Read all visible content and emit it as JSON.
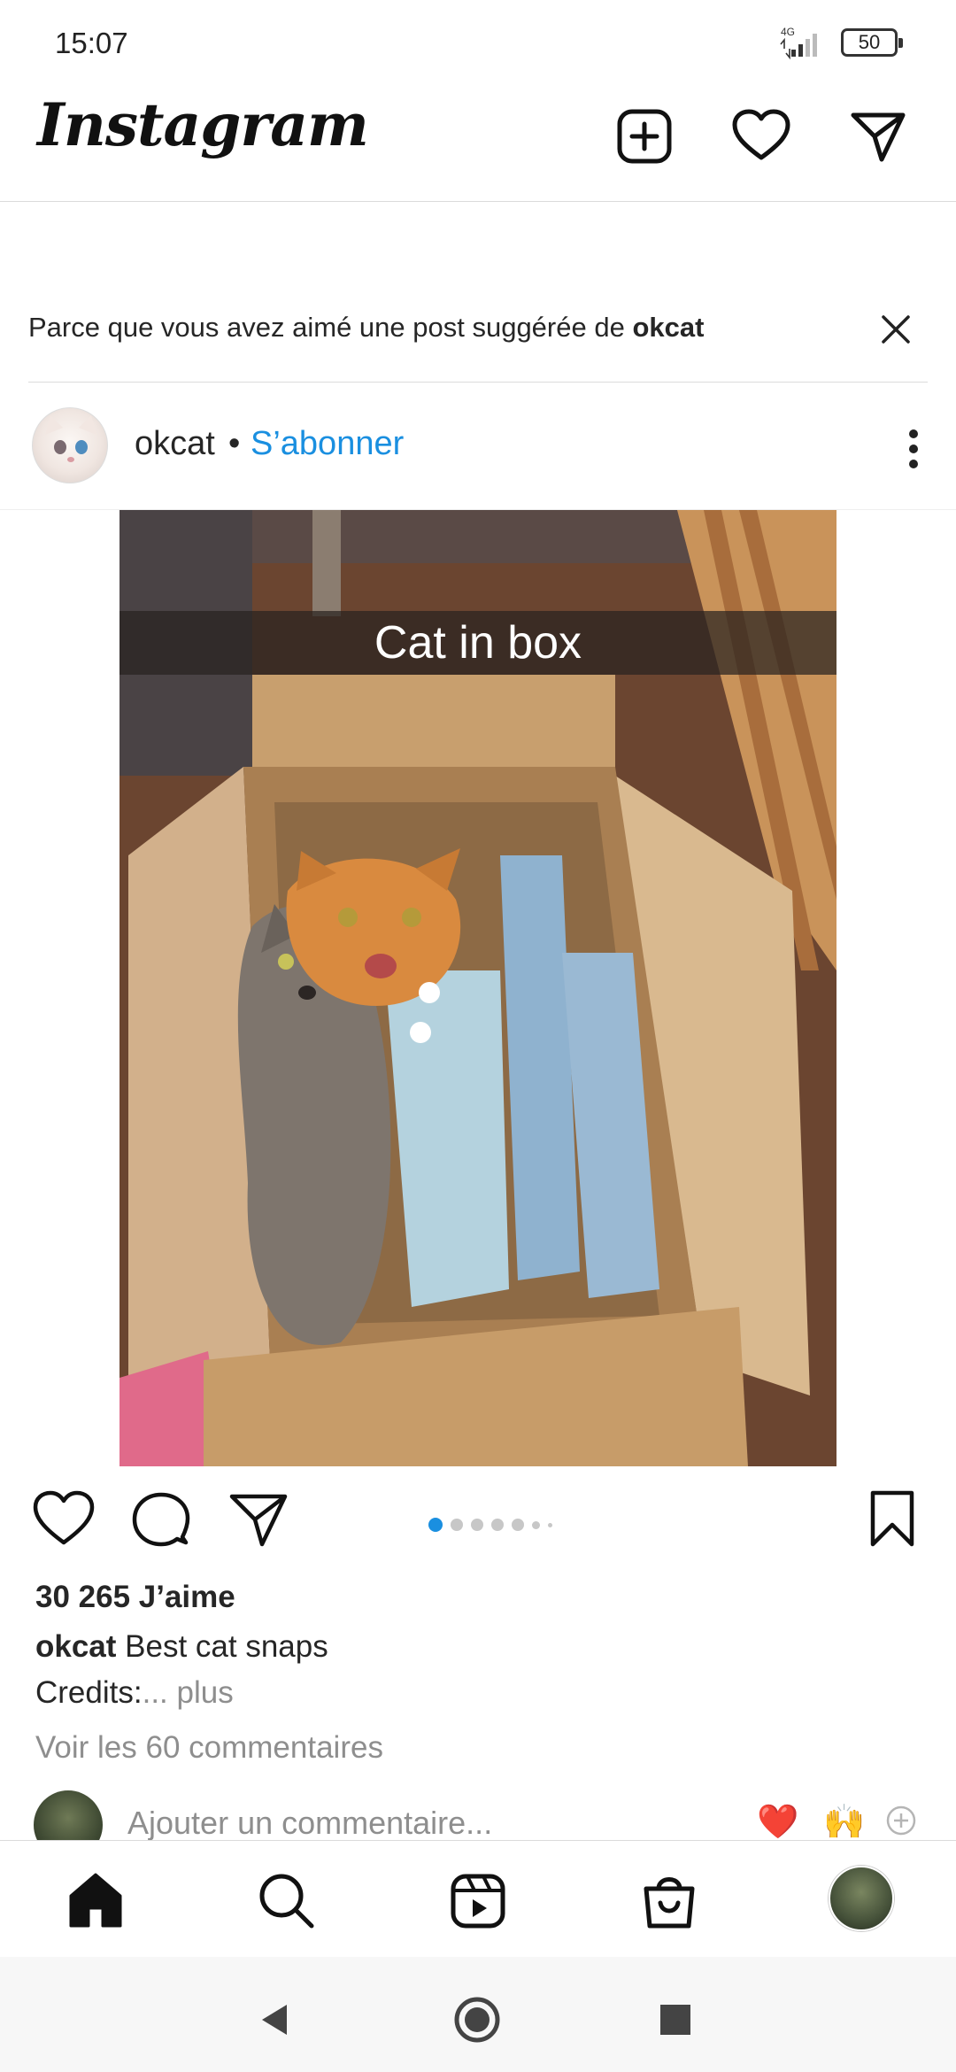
{
  "status_bar": {
    "time": "15:07",
    "network": "4G",
    "battery": "50"
  },
  "header": {
    "logo": "Instagram",
    "icons": [
      "new-post-icon",
      "activity-heart-icon",
      "direct-messages-icon"
    ]
  },
  "suggestion": {
    "text": "Parce que vous avez aimé une post suggérée de ",
    "account": "okcat"
  },
  "post": {
    "username": "okcat",
    "separator": "•",
    "follow_label": "S’abonner",
    "image_caption": "Cat in box",
    "carousel_count": 7,
    "carousel_active_index": 0,
    "likes": "30 265 J’aime",
    "caption_user": "okcat",
    "caption_text": "Best cat snaps",
    "credits": "Credits:",
    "more_label": "... plus",
    "view_comments": "Voir les 60 commentaires",
    "comment_placeholder": "Ajouter un commentaire...",
    "quick_reactions": [
      "❤️",
      "🙌"
    ]
  },
  "bottom_nav": {
    "items": [
      "home-icon",
      "search-icon",
      "reels-icon",
      "shop-icon",
      "profile-avatar"
    ]
  },
  "colors": {
    "accent": "#1a8fe0",
    "text": "#262626",
    "muted": "#8e8e8e"
  }
}
